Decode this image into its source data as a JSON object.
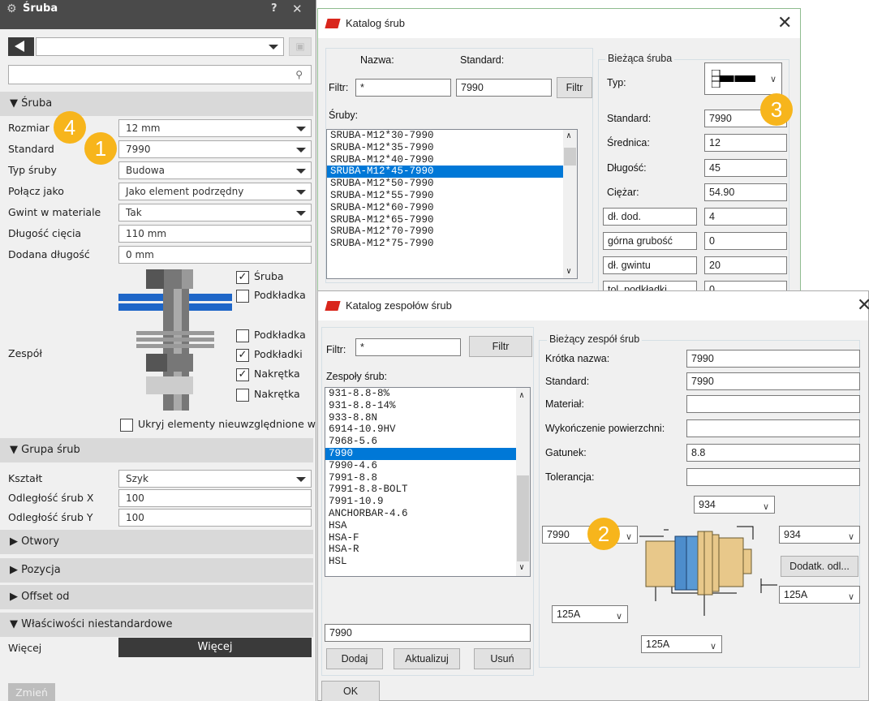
{
  "left_panel": {
    "title": "Śruba",
    "help": "?",
    "close": "✕",
    "sections": {
      "sruba": "▼ Śruba",
      "grupa": "▼ Grupa śrub",
      "otwory": "▶ Otwory",
      "pozycja": "▶ Pozycja",
      "offset": "▶ Offset od",
      "wlasciwosci": "▼ Właściwości niestandardowe"
    },
    "props": [
      {
        "label": "Rozmiar",
        "value": "12 mm",
        "dropdown": true
      },
      {
        "label": "Standard",
        "value": "7990",
        "dropdown": true
      },
      {
        "label": "Typ śruby",
        "value": "Budowa",
        "dropdown": true
      },
      {
        "label": "Połącz jako",
        "value": "Jako element podrzędny",
        "dropdown": true
      },
      {
        "label": "Gwint w materiale",
        "value": "Tak",
        "dropdown": true
      },
      {
        "label": "Długość cięcia",
        "value": "110 mm",
        "dropdown": false
      },
      {
        "label": "Dodana długość",
        "value": "0 mm",
        "dropdown": false
      }
    ],
    "zespol_label": "Zespół",
    "checks": [
      {
        "label": "Śruba",
        "checked": true
      },
      {
        "label": "Podkładka",
        "checked": false
      },
      {
        "label": "Podkładka",
        "checked": false
      },
      {
        "label": "Podkładki",
        "checked": true
      },
      {
        "label": "Nakrętka",
        "checked": true
      },
      {
        "label": "Nakrętka",
        "checked": false
      }
    ],
    "hide_label": "Ukryj elementy nieuwzględnione w",
    "group_props": [
      {
        "label": "Kształt",
        "value": "Szyk",
        "dropdown": true
      },
      {
        "label": "Odległość śrub X",
        "value": "100",
        "dropdown": false
      },
      {
        "label": "Odległość śrub Y",
        "value": "100",
        "dropdown": false
      }
    ],
    "wiecej_label": "Więcej",
    "wiecej_button": "Więcej",
    "zmien": "Zmień"
  },
  "dialog_katalog": {
    "title": "Katalog śrub",
    "close": "✕",
    "nazwa_label": "Nazwa:",
    "standard_label": "Standard:",
    "filtr_label": "Filtr:",
    "filtr_value": "*",
    "standard_value": "7990",
    "filtr_button": "Filtr",
    "sruby_label": "Śruby:",
    "items": [
      "SRUBA-M12*30-7990",
      "SRUBA-M12*35-7990",
      "SRUBA-M12*40-7990",
      "SRUBA-M12*45-7990",
      "SRUBA-M12*50-7990",
      "SRUBA-M12*55-7990",
      "SRUBA-M12*60-7990",
      "SRUBA-M12*65-7990",
      "SRUBA-M12*70-7990",
      "SRUBA-M12*75-7990"
    ],
    "selected_index": 3,
    "group_title": "Bieżąca śruba",
    "typ_label": "Typ:",
    "fields": [
      {
        "label": "Standard:",
        "value": "7990"
      },
      {
        "label": "Średnica:",
        "value": "12"
      },
      {
        "label": "Długość:",
        "value": "45"
      },
      {
        "label": "Ciężar:",
        "value": "54.90"
      },
      {
        "label": "dł. dod.",
        "value": "4"
      },
      {
        "label": "górna grubość",
        "value": "0"
      },
      {
        "label": "dł. gwintu",
        "value": "20"
      },
      {
        "label": "tol. podkładki",
        "value": "0"
      }
    ]
  },
  "dialog_zespoly": {
    "title": "Katalog zespołów śrub",
    "close": "✕",
    "filtr_label": "Filtr:",
    "filtr_value": "*",
    "filtr_button": "Filtr",
    "list_label": "Zespoły śrub:",
    "items": [
      "931-8.8-8%",
      "931-8.8-14%",
      "933-8.8N",
      "6914-10.9HV",
      "7968-5.6",
      "7990",
      "7990-4.6",
      "7991-8.8",
      "7991-8.8-BOLT",
      "7991-10.9",
      "ANCHORBAR-4.6",
      "HSA",
      "HSA-F",
      "HSA-R",
      "HSL"
    ],
    "selected_index": 5,
    "name_value": "7990",
    "buttons": {
      "dodaj": "Dodaj",
      "aktualizuj": "Aktualizuj",
      "usun": "Usuń",
      "ok": "OK",
      "dodatk": "Dodatk. odl..."
    },
    "group_title": "Bieżący zespół śrub",
    "fields": [
      {
        "label": "Krótka nazwa:",
        "value": "7990"
      },
      {
        "label": "Standard:",
        "value": "7990"
      },
      {
        "label": "Materiał:",
        "value": ""
      },
      {
        "label": "Wykończenie powierzchni:",
        "value": ""
      },
      {
        "label": "Gatunek:",
        "value": "8.8"
      },
      {
        "label": "Tolerancja:",
        "value": ""
      }
    ],
    "combos": {
      "top": "934",
      "left": "7990",
      "right": "934",
      "right2": "125A",
      "bottom_left": "125A",
      "bottom": "125A"
    }
  },
  "badges": [
    "1",
    "2",
    "3",
    "4"
  ],
  "colors": {
    "accent": "#f7b51c",
    "selection": "#0078d7",
    "title_dark": "#4a4a4a",
    "flag": "#d9261c"
  }
}
